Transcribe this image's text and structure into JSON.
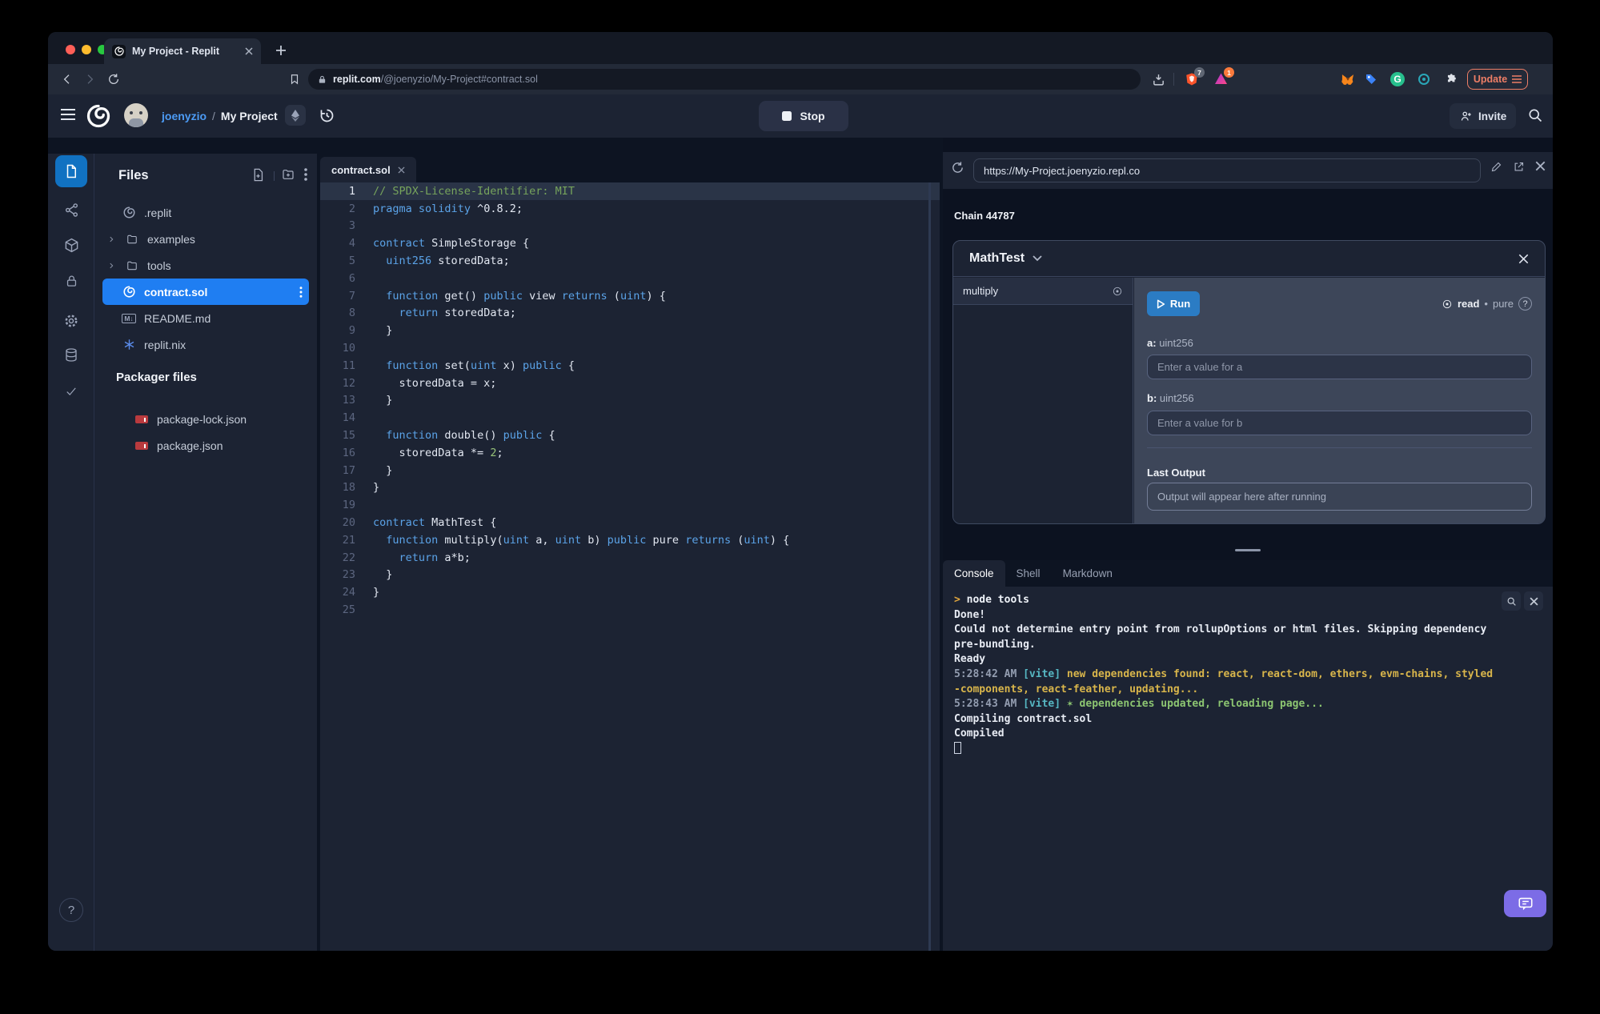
{
  "colors": {
    "selection_blue": "#1f7ef2",
    "rail_active_blue": "#1172c2",
    "run_blue": "#2b7cc4",
    "update_orange": "#ee7e66",
    "brave_orange": "#fb542b",
    "chat_purple": "#7c6ce6",
    "keyword_blue": "#5ba3e8",
    "comment_green": "#77a45c",
    "number_green": "#98c379",
    "console_yellow": "#d8b54b",
    "console_cyan": "#56b7c3",
    "console_green": "#8cc571"
  },
  "browser": {
    "tab_title": "My Project - Replit",
    "url_domain": "replit.com",
    "url_path": "/@joenyzio/My-Project#contract.sol",
    "shield_badge": "7",
    "rewards_badge": "1",
    "update_label": "Update",
    "grammarly_letter": "G"
  },
  "header": {
    "username": "joenyzio",
    "separator": "/",
    "project": "My Project",
    "stop_label": "Stop",
    "invite_label": "Invite"
  },
  "files": {
    "title": "Files",
    "items": [
      {
        "name": ".replit",
        "icon": "replit",
        "kind": "file"
      },
      {
        "name": "examples",
        "icon": "folder",
        "kind": "folder"
      },
      {
        "name": "tools",
        "icon": "folder",
        "kind": "folder"
      },
      {
        "name": "contract.sol",
        "icon": "solidity",
        "kind": "file",
        "selected": true
      },
      {
        "name": "README.md",
        "icon": "markdown",
        "kind": "file"
      },
      {
        "name": "replit.nix",
        "icon": "nix",
        "kind": "file"
      }
    ],
    "packager_title": "Packager files",
    "packager_items": [
      {
        "name": "package-lock.json",
        "icon": "npm"
      },
      {
        "name": "package.json",
        "icon": "npm"
      }
    ],
    "help_label": "?"
  },
  "editor": {
    "tab_label": "contract.sol",
    "active_line": 1,
    "lines": [
      [
        [
          "c",
          "// SPDX-License-Identifier: MIT"
        ]
      ],
      [
        [
          "k",
          "pragma"
        ],
        [
          "p",
          " "
        ],
        [
          "k",
          "solidity"
        ],
        [
          "p",
          " ^0.8.2;"
        ]
      ],
      [],
      [
        [
          "k",
          "contract"
        ],
        [
          "p",
          " SimpleStorage {"
        ]
      ],
      [
        [
          "p",
          "  "
        ],
        [
          "k",
          "uint256"
        ],
        [
          "p",
          " storedData;"
        ]
      ],
      [],
      [
        [
          "p",
          "  "
        ],
        [
          "k",
          "function"
        ],
        [
          "p",
          " get() "
        ],
        [
          "k",
          "public"
        ],
        [
          "p",
          " view "
        ],
        [
          "k",
          "returns"
        ],
        [
          "p",
          " ("
        ],
        [
          "k",
          "uint"
        ],
        [
          "p",
          ") {"
        ]
      ],
      [
        [
          "p",
          "    "
        ],
        [
          "k",
          "return"
        ],
        [
          "p",
          " storedData;"
        ]
      ],
      [
        [
          "p",
          "  }"
        ]
      ],
      [],
      [
        [
          "p",
          "  "
        ],
        [
          "k",
          "function"
        ],
        [
          "p",
          " set("
        ],
        [
          "k",
          "uint"
        ],
        [
          "p",
          " x) "
        ],
        [
          "k",
          "public"
        ],
        [
          "p",
          " {"
        ]
      ],
      [
        [
          "p",
          "    storedData = x;"
        ]
      ],
      [
        [
          "p",
          "  }"
        ]
      ],
      [],
      [
        [
          "p",
          "  "
        ],
        [
          "k",
          "function"
        ],
        [
          "p",
          " double() "
        ],
        [
          "k",
          "public"
        ],
        [
          "p",
          " {"
        ]
      ],
      [
        [
          "p",
          "    storedData *= "
        ],
        [
          "n",
          "2"
        ],
        [
          "p",
          ";"
        ]
      ],
      [
        [
          "p",
          "  }"
        ]
      ],
      [
        [
          "p",
          "}"
        ]
      ],
      [],
      [
        [
          "k",
          "contract"
        ],
        [
          "p",
          " MathTest {"
        ]
      ],
      [
        [
          "p",
          "  "
        ],
        [
          "k",
          "function"
        ],
        [
          "p",
          " multiply("
        ],
        [
          "k",
          "uint"
        ],
        [
          "p",
          " a, "
        ],
        [
          "k",
          "uint"
        ],
        [
          "p",
          " b) "
        ],
        [
          "k",
          "public"
        ],
        [
          "p",
          " pure "
        ],
        [
          "k",
          "returns"
        ],
        [
          "p",
          " ("
        ],
        [
          "k",
          "uint"
        ],
        [
          "p",
          ") {"
        ]
      ],
      [
        [
          "p",
          "    "
        ],
        [
          "k",
          "return"
        ],
        [
          "p",
          " a*b;"
        ]
      ],
      [
        [
          "p",
          "  }"
        ]
      ],
      [
        [
          "p",
          "}"
        ]
      ],
      []
    ]
  },
  "webview": {
    "url": "https://My-Project.joenyzio.repl.co",
    "chain_label": "Chain 44787",
    "contract_name": "MathTest",
    "function_name": "multiply",
    "run_label": "Run",
    "access_label": "read",
    "dot": "•",
    "purity_label": "pure",
    "help_label": "?",
    "params": [
      {
        "label": "a:",
        "type": "uint256",
        "placeholder": "Enter a value for a"
      },
      {
        "label": "b:",
        "type": "uint256",
        "placeholder": "Enter a value for b"
      }
    ],
    "last_output_label": "Last Output",
    "output_placeholder": "Output will appear here after running"
  },
  "console": {
    "tabs": [
      {
        "label": "Console",
        "active": true
      },
      {
        "label": "Shell",
        "active": false
      },
      {
        "label": "Markdown",
        "active": false
      }
    ],
    "lines": [
      [
        [
          "prompt",
          "> "
        ],
        [
          "cmd",
          "node tools"
        ]
      ],
      [
        [
          "white",
          "Done!"
        ]
      ],
      [
        [
          "white",
          "Could not determine entry point from rollupOptions or html files. Skipping dependency"
        ]
      ],
      [
        [
          "white",
          "pre-bundling."
        ]
      ],
      [
        [
          "white",
          "Ready"
        ]
      ],
      [
        [
          "gray",
          "5:28:42 AM "
        ],
        [
          "cyan",
          "[vite]"
        ],
        [
          "yellow",
          " new dependencies found: react, react-dom, ethers, evm-chains, styled"
        ]
      ],
      [
        [
          "yellow",
          "-components, react-feather, updating..."
        ]
      ],
      [
        [
          "gray",
          "5:28:43 AM "
        ],
        [
          "cyan",
          "[vite]"
        ],
        [
          "green",
          " ✶ dependencies updated, reloading page..."
        ]
      ],
      [
        [
          "white",
          "Compiling contract.sol"
        ]
      ],
      [
        [
          "white",
          "Compiled"
        ]
      ],
      [
        [
          "cursor",
          ""
        ]
      ]
    ]
  }
}
